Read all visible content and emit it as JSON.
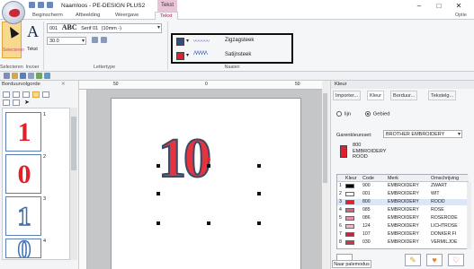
{
  "window": {
    "title": "Naamloos - PE-DESIGN PLUS2",
    "context_tab": "Tekst",
    "controls": [
      "–",
      "□",
      "✕"
    ]
  },
  "tabs": [
    {
      "label": "Beginscherm"
    },
    {
      "label": "Afbeelding"
    },
    {
      "label": "Weergave"
    },
    {
      "label": "Tekst"
    }
  ],
  "options_label": "Optie",
  "ribbon": {
    "select_label": "Selecteren",
    "text_label": "Tekst",
    "font_number": "001",
    "font_sample": "ABC",
    "font_name": "Serif 01",
    "font_size_hint": "(10mm -)",
    "size_value": "30.0",
    "groups": {
      "select": "Selecteren",
      "insert": "Invoer",
      "font": "Lettertype",
      "threads": "Naaien"
    },
    "outline_stitch": "Zigzagsteek",
    "fill_stitch": "Satijnsteek",
    "outline_color": "#2f4d8c",
    "fill_color": "#e0202c"
  },
  "left_panel": {
    "title": "Borduurvolgorde",
    "close": "✕",
    "items": [
      {
        "char": "1",
        "number": "1",
        "color": "#e0202c"
      },
      {
        "char": "0",
        "number": "2",
        "color": "#e0202c"
      },
      {
        "char": "1",
        "number": "3",
        "color": "#3d6eb4"
      },
      {
        "char": "0",
        "number": "4",
        "color": "#3d6eb4"
      }
    ]
  },
  "canvas": {
    "text": "10",
    "ruler_marks": [
      "50",
      "0",
      "50"
    ]
  },
  "right_panel": {
    "title": "Kleur",
    "tabs": [
      "Importer...",
      "Kleur",
      "Borduur...",
      "Tekstelg..."
    ],
    "radio_line": "lijn",
    "radio_area": "Gebied",
    "brand_label": "Garenkleursset:",
    "brand_value": "BROTHER EMBROIDERY",
    "current_thread": {
      "code": "800",
      "brand": "EMBROIDERY",
      "name": "ROOD"
    },
    "table_headers": [
      "Kleur",
      "Code",
      "Merk",
      "Omschrijving"
    ],
    "rows": [
      {
        "idx": "1",
        "color": "#000000",
        "code": "900",
        "brand": "EMBROIDERY",
        "desc": "ZWART"
      },
      {
        "idx": "2",
        "color": "#ffffff",
        "code": "001",
        "brand": "EMBROIDERY",
        "desc": "WIT"
      },
      {
        "idx": "3",
        "color": "#e0202c",
        "code": "800",
        "brand": "EMBROIDERY",
        "desc": "ROOD"
      },
      {
        "idx": "4",
        "color": "#e0607a",
        "code": "085",
        "brand": "EMBROIDERY",
        "desc": "ROSE"
      },
      {
        "idx": "5",
        "color": "#e890a8",
        "code": "086",
        "brand": "EMBROIDERY",
        "desc": "ROSERODE"
      },
      {
        "idx": "6",
        "color": "#f4b6c8",
        "code": "124",
        "brand": "EMBROIDERY",
        "desc": "LICHTROSE"
      },
      {
        "idx": "7",
        "color": "#c0284a",
        "code": "107",
        "brand": "EMBROIDERY",
        "desc": "DONKER FI"
      },
      {
        "idx": "8",
        "color": "#d03848",
        "code": "030",
        "brand": "EMBROIDERY",
        "desc": "VERMILJOE"
      }
    ],
    "palette_button": "Naar palemodus"
  }
}
